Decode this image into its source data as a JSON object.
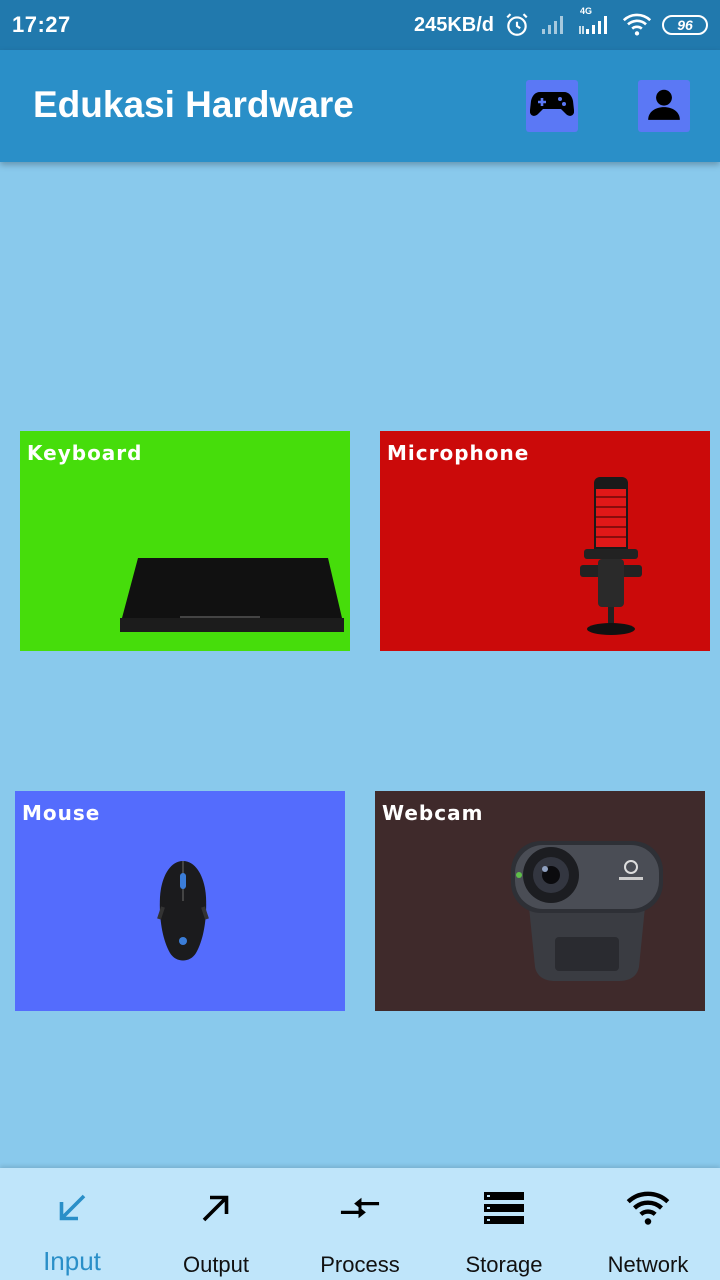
{
  "status_bar": {
    "time": "17:27",
    "net_speed": "245KB/d",
    "network_type": "4G",
    "battery": "96",
    "icons": [
      "alarm-icon",
      "signal-icon",
      "signal-4g-icon",
      "wifi-icon",
      "battery-icon"
    ]
  },
  "app_bar": {
    "title": "Edukasi Hardware",
    "buttons": [
      "gamepad-icon",
      "person-icon"
    ],
    "button_color": "#5b78f5"
  },
  "cards": [
    {
      "label": "Keyboard",
      "color": "#46dd0b"
    },
    {
      "label": "Microphone",
      "color": "#cb0a0a"
    },
    {
      "label": "Mouse",
      "color": "#546cfd"
    },
    {
      "label": "Webcam",
      "color": "#3f2a2b"
    }
  ],
  "bottom_nav": {
    "items": [
      {
        "label": "Input",
        "icon": "arrow-down-left-icon",
        "active": true
      },
      {
        "label": "Output",
        "icon": "arrow-up-right-icon",
        "active": false
      },
      {
        "label": "Process",
        "icon": "compare-arrows-icon",
        "active": false
      },
      {
        "label": "Storage",
        "icon": "storage-icon",
        "active": false
      },
      {
        "label": "Network",
        "icon": "wifi-icon",
        "active": false
      }
    ],
    "active_color": "#2a8fc8"
  },
  "colors": {
    "status_bar": "#2179ad",
    "app_bar": "#2a8fc8",
    "background": "#89c9ec",
    "bottom_nav": "#bfe5fa"
  }
}
